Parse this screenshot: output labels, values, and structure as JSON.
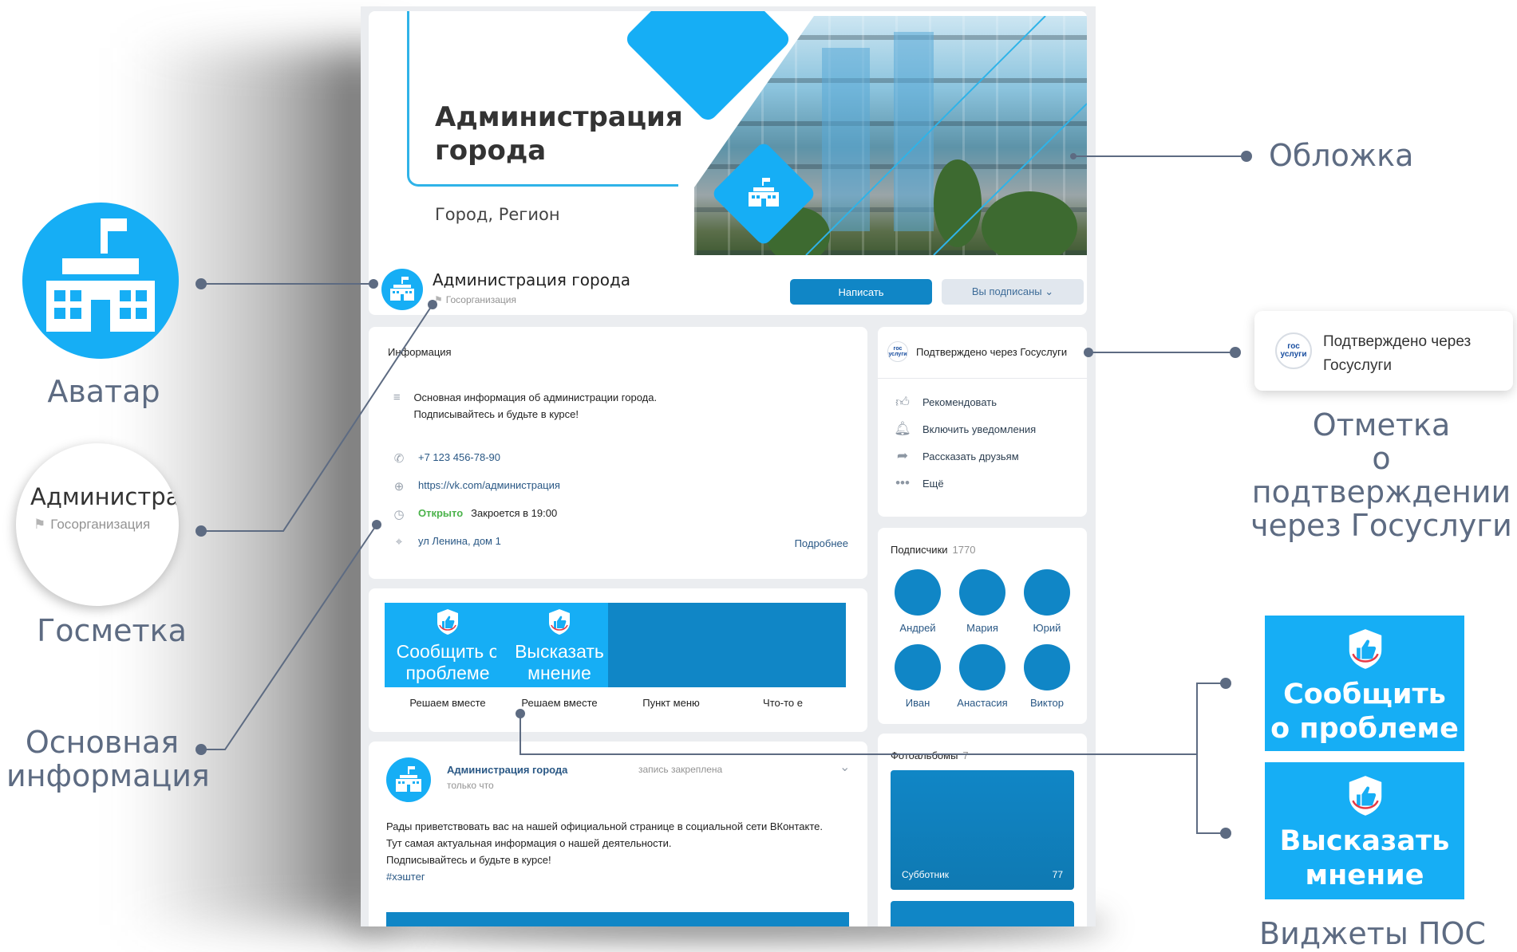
{
  "cover": {
    "title": "Администрация города",
    "subtitle": "Город, Регион"
  },
  "group": {
    "name": "Администрация города",
    "badge": "Госорганизация",
    "write_button": "Написать",
    "subscribed_button": "Вы подписаны ⌄"
  },
  "info": {
    "title": "Информация",
    "description": "Основная информация об администрации города. Подписывайтесь и будьте в курсе!",
    "phone": "+7 123 456-78-90",
    "website": "https://vk.com/администрация",
    "status_open": "Открыто",
    "closes": "Закроется в 19:00",
    "address": "ул Ленина, дом 1",
    "more": "Подробнее"
  },
  "widgets": [
    {
      "text": "Сообщить о проблеме",
      "caption": "Решаем вместе"
    },
    {
      "text": "Высказать мнение",
      "caption": "Решаем вместе"
    },
    {
      "text": "",
      "caption": "Пункт меню"
    },
    {
      "text": "",
      "caption": "Что-то е"
    }
  ],
  "post": {
    "author": "Администрация города",
    "time": "только что",
    "pinned": "запись закреплена",
    "line1": "Рады приветствовать вас на нашей официальной странице в социальной сети ВКонтакте.",
    "line2": "Тут самая актуальная информация о нашей деятельности.",
    "line3": "Подписывайтесь и будьте в курсе!",
    "hashtag": "#хэштег"
  },
  "actions": {
    "gos_verified": "Подтверждено через Госуслуги",
    "gos_logo": "гос услуги",
    "recommend": "Рекомендовать",
    "notify": "Включить уведомления",
    "share": "Рассказать друзьям",
    "more": "Ещё"
  },
  "subscribers": {
    "title": "Подписчики",
    "count": "1770",
    "people": [
      "Андрей",
      "Мария",
      "Юрий",
      "Иван",
      "Анастасия",
      "Виктор"
    ]
  },
  "albums": {
    "title": "Фотоальбомы",
    "count": "7",
    "album_name": "Субботник",
    "album_count": "77"
  },
  "annotations": {
    "cover": "Обложка",
    "avatar": "Аватар",
    "gosmark": "Госметка",
    "main_info_1": "Основная",
    "main_info_2": "информация",
    "gos_note_1": "Отметка",
    "gos_note_2": "о подтверждении",
    "gos_note_3": "через Госуслуги",
    "gos_card_text_1": "Подтверждено через",
    "gos_card_text_2": "Госуслуги",
    "pos_widgets": "Виджеты ПОС",
    "mag_title": "Администрац",
    "mag_badge": "Госорганизация",
    "big_widget_1a": "Сообщить",
    "big_widget_1b": "о проблеме",
    "big_widget_2a": "Высказать",
    "big_widget_2b": "мнение"
  },
  "colors": {
    "brand_blue": "#16aef5",
    "vk_blue": "#1086c6",
    "link": "#2a5885",
    "open_green": "#4bb34b",
    "annotation_text": "#5d6b82"
  }
}
